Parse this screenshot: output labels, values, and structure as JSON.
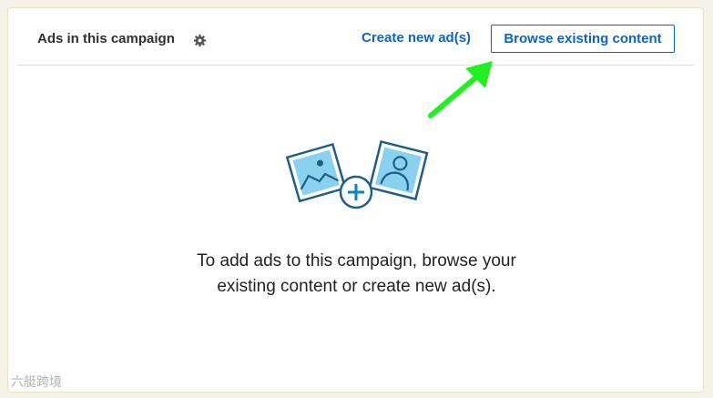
{
  "header": {
    "title": "Ads in this campaign",
    "settings_icon": "gear-icon",
    "create_label": "Create new ad(s)",
    "browse_label": "Browse existing content"
  },
  "empty_state": {
    "illustration": "image-plus-profile-icon",
    "message": "To add ads to this campaign, browse your existing content or create new ad(s)."
  },
  "watermark": "六艇跨境",
  "colors": {
    "accent": "#0a66c2",
    "annotation_arrow": "#22ee22",
    "illustration_fill": "#8ad1f0",
    "illustration_stroke": "#1e5f88"
  }
}
